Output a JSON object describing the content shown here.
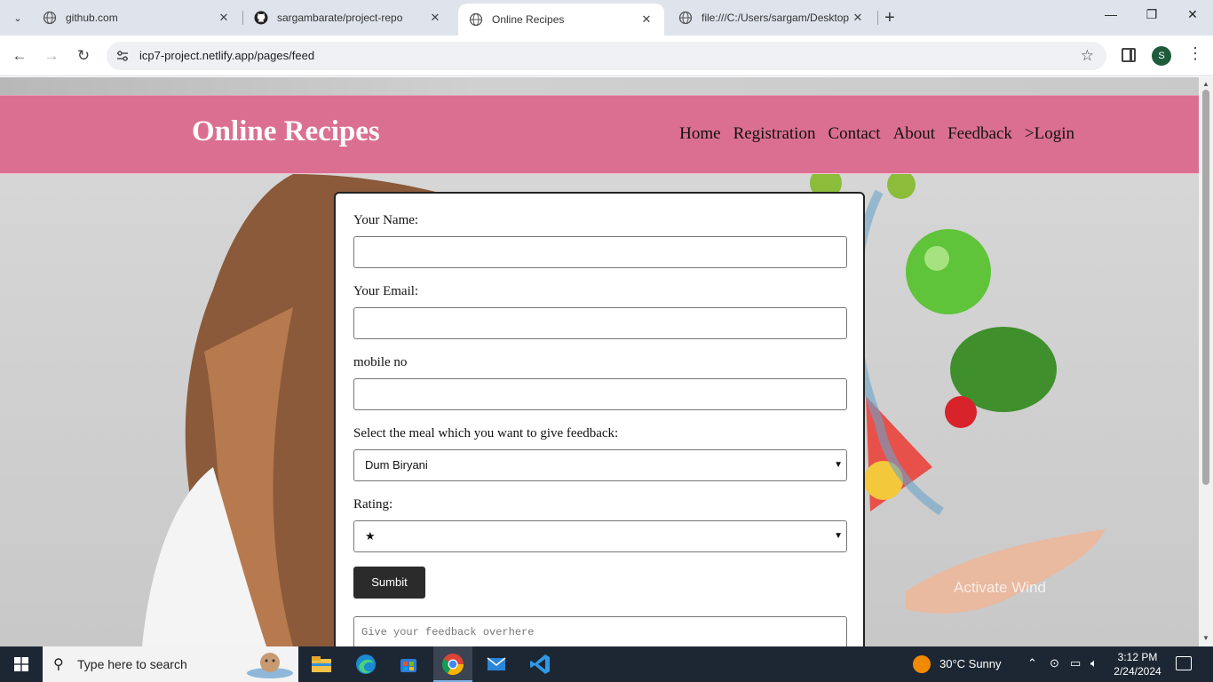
{
  "browser": {
    "tabs": [
      {
        "title": "github.com",
        "active": false
      },
      {
        "title": "sargambarate/project-repo",
        "active": false
      },
      {
        "title": "Online Recipes",
        "active": true
      },
      {
        "title": "file:///C:/Users/sargam/Desktop",
        "active": false
      }
    ],
    "url": "icp7-project.netlify.app/pages/feed",
    "profile_initial": "S"
  },
  "site": {
    "brand": "Online Recipes",
    "nav": [
      "Home",
      "Registration",
      "Contact",
      "About",
      "Feedback",
      ">Login"
    ]
  },
  "form": {
    "name_label": "Your Name:",
    "email_label": "Your Email:",
    "mobile_label": "mobile no",
    "meal_label": "Select the meal which you want to give feedback:",
    "meal_selected": "Dum Biryani",
    "rating_label": "Rating:",
    "rating_selected": "★",
    "submit_label": "Sumbit",
    "feedback_placeholder": "Give your feedback overhere"
  },
  "watermark": "Activate Wind",
  "taskbar": {
    "search_text": "Type here to search",
    "weather": "30°C  Sunny",
    "time": "3:12 PM",
    "date": "2/24/2024"
  }
}
